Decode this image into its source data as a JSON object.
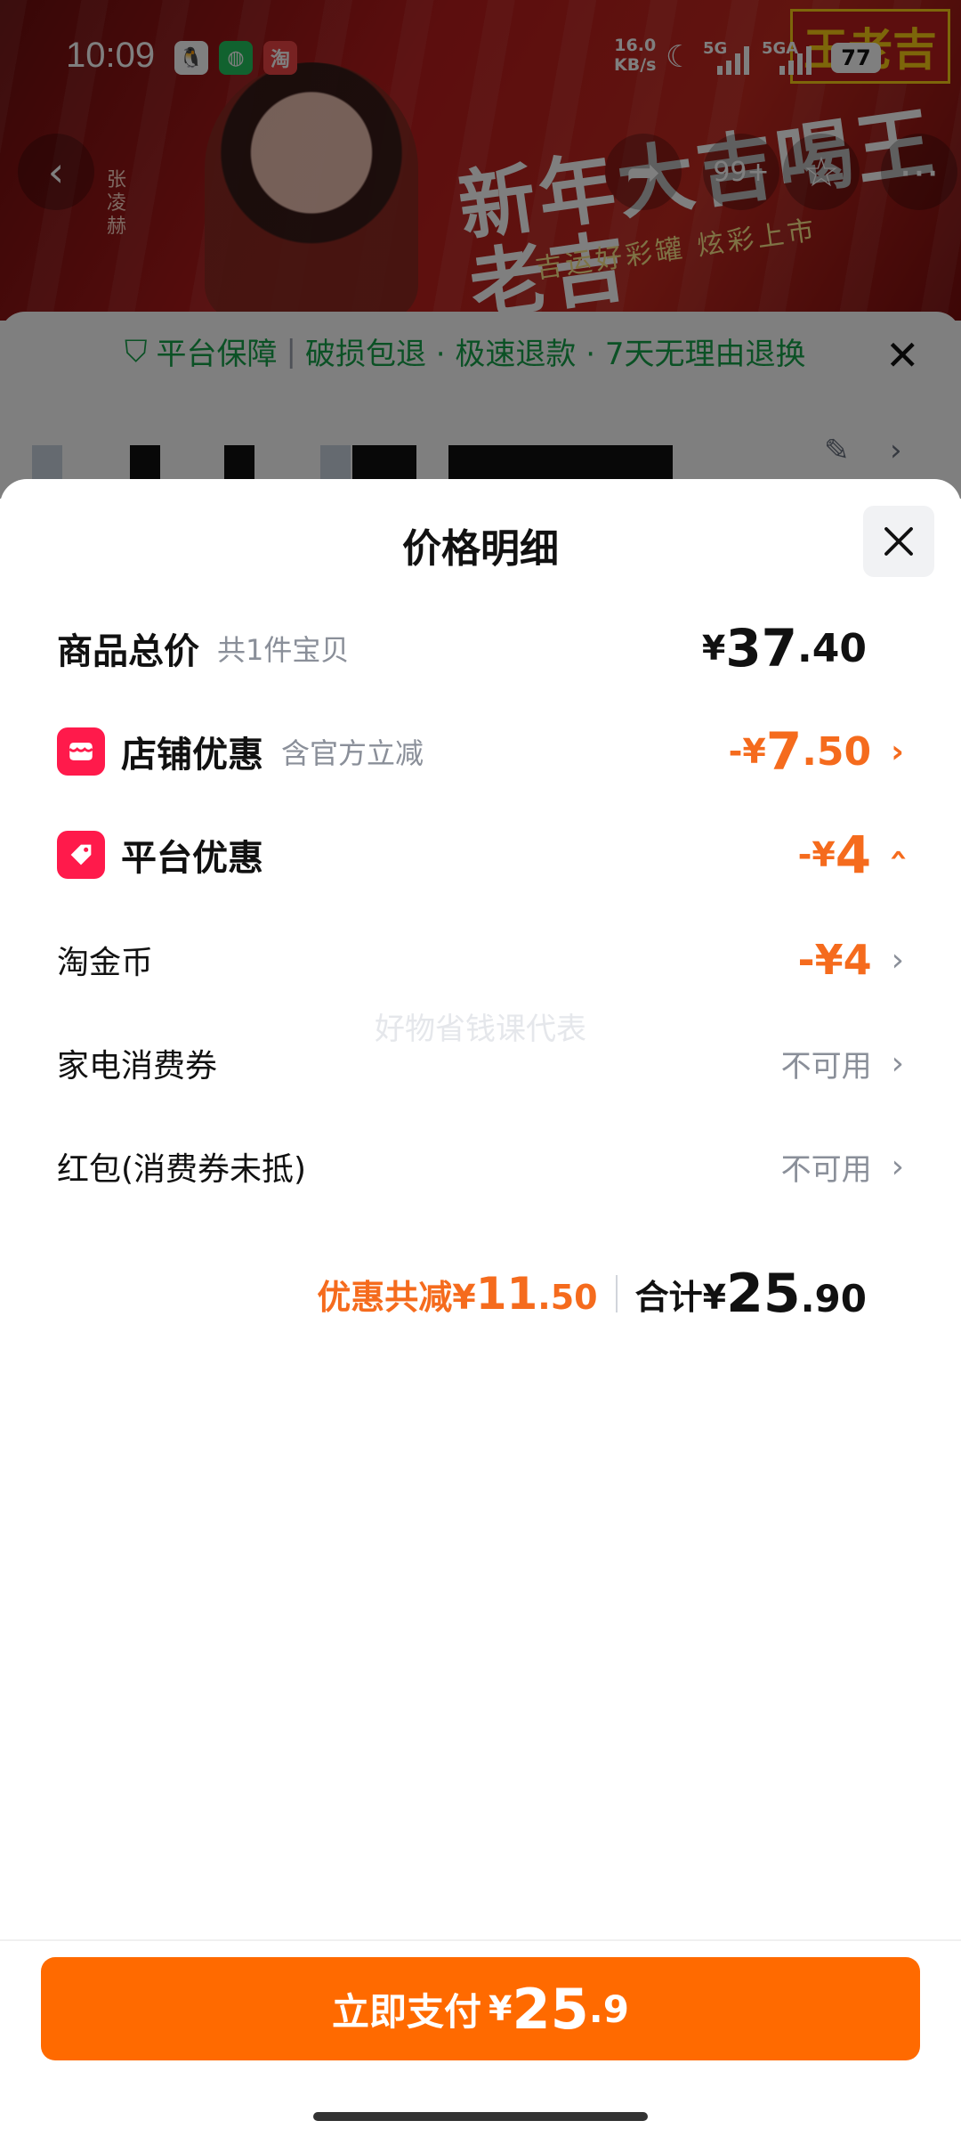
{
  "status_bar": {
    "time": "10:09",
    "apps": [
      "QQ",
      "WeChat",
      "淘"
    ],
    "speed_value": "16.0",
    "speed_unit": "KB/s",
    "net1": "5G",
    "net2": "5GA",
    "battery": "77"
  },
  "background": {
    "banner_slogan": "新年大吉喝王老吉",
    "banner_sub": "吉运好彩罐 炫彩上市",
    "brand_badge": "王老吉",
    "person_name_vertical": "张凌赫",
    "guarantee_title": "平台保障",
    "guarantee_items": "破损包退 · 极速退款 · 7天无理由退换",
    "cart_badge": "99+"
  },
  "sheet": {
    "title": "价格明细",
    "watermark": "好物省钱课代表",
    "rows": {
      "goods_total": {
        "label": "商品总价",
        "sub": "共1件宝贝",
        "symbol": "¥",
        "int": "37",
        "dec": ".40"
      },
      "shop_discount": {
        "label": "店铺优惠",
        "sub": "含官方立减",
        "sign": "-",
        "symbol": "¥",
        "int": "7",
        "dec": ".50"
      },
      "platform_discount": {
        "label": "平台优惠",
        "sign": "-",
        "symbol": "¥",
        "int": "4"
      },
      "taojinbi": {
        "label": "淘金币",
        "value": "-¥4"
      },
      "appliance_coupon": {
        "label": "家电消费券",
        "value": "不可用"
      },
      "red_packet": {
        "label": "红包(消费券未抵)",
        "value": "不可用"
      }
    },
    "summary": {
      "save_label": "优惠共减",
      "save_symbol": "¥",
      "save_int": "11",
      "save_dec": ".50",
      "total_label": "合计",
      "total_symbol": "¥",
      "total_int": "25",
      "total_dec": ".90"
    }
  },
  "pay_button": {
    "label": "立即支付",
    "symbol": "¥",
    "int": "25",
    "dec": ".9"
  },
  "colors": {
    "accent_orange": "#f56b1d",
    "button_orange": "#ff6a00",
    "badge_red": "#ff1a4b",
    "guarantee_green": "#16a34a"
  }
}
